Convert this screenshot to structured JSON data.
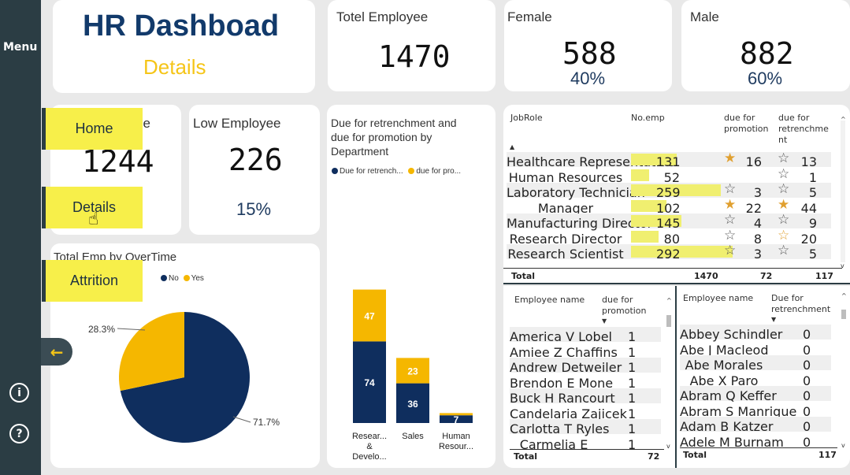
{
  "sidebar": {
    "menu_label": "Menu",
    "info_icon": "i",
    "help_icon": "?"
  },
  "nav": {
    "home": "Home",
    "details": "Details",
    "attrition": "Attrition"
  },
  "header": {
    "title": "HR Dashboad",
    "subtitle": "Details"
  },
  "kpis": {
    "total": {
      "label": "Totel Employee",
      "value": "1470"
    },
    "female": {
      "label": "Female",
      "value": "588",
      "pct": "40%"
    },
    "male": {
      "label": "Male",
      "value": "882",
      "pct": "60%"
    },
    "high": {
      "label": "ee",
      "value": "1244"
    },
    "low": {
      "label": "Low Employee",
      "value": "226",
      "pct": "15%"
    }
  },
  "overtime": {
    "title": "Total Emp by OverTime",
    "legend_no": "No",
    "legend_yes": "Yes",
    "label_yes": "28.3%",
    "label_no": "71.7%"
  },
  "dept_chart": {
    "title_l1": "Due for retrenchment and",
    "title_l2": "due for promotion by",
    "title_l3": "Department",
    "legend_a": "Due for retrench...",
    "legend_b": "due for pro..."
  },
  "chart_data": {
    "type": "bar",
    "stacked": true,
    "categories": [
      "Resear... & Develo...",
      "Sales",
      "Human Resour..."
    ],
    "category_lines": [
      [
        "Resear...",
        "&",
        "Develo..."
      ],
      [
        "Sales"
      ],
      [
        "Human",
        "Resour..."
      ]
    ],
    "series": [
      {
        "name": "Due for retrench...",
        "color": "#0f2e5e",
        "values": [
          74,
          36,
          7
        ]
      },
      {
        "name": "due for pro...",
        "color": "#f5b700",
        "values": [
          47,
          23,
          2
        ]
      }
    ],
    "pie": {
      "values": [
        71.7,
        28.3
      ],
      "names": [
        "No",
        "Yes"
      ],
      "colors": [
        "#0f2e5e",
        "#f5b700"
      ]
    }
  },
  "jobrole": {
    "headers": {
      "role": "JobRole",
      "emp": "No.emp",
      "promo_l1": "due for",
      "promo_l2": "promotion",
      "ret_l1": "due for",
      "ret_l2": "retrenchme",
      "ret_l3": "nt"
    },
    "rows": [
      {
        "role": "Healthcare Representative",
        "emp": "131",
        "empv": 131,
        "promo": "16",
        "pstar": "full",
        "ret": "13",
        "rstar": "empty"
      },
      {
        "role": "Human Resources",
        "emp": "52",
        "empv": 52,
        "promo": "",
        "pstar": "none",
        "ret": "1",
        "rstar": "empty"
      },
      {
        "role": "Laboratory Technician",
        "emp": "259",
        "empv": 259,
        "promo": "3",
        "pstar": "empty",
        "ret": "5",
        "rstar": "empty"
      },
      {
        "role": "Manager",
        "emp": "102",
        "empv": 102,
        "promo": "22",
        "pstar": "full",
        "ret": "44",
        "rstar": "full"
      },
      {
        "role": "Manufacturing Director",
        "emp": "145",
        "empv": 145,
        "promo": "4",
        "pstar": "empty",
        "ret": "9",
        "rstar": "empty"
      },
      {
        "role": "Research Director",
        "emp": "80",
        "empv": 80,
        "promo": "8",
        "pstar": "empty",
        "ret": "20",
        "rstar": "half"
      },
      {
        "role": "Research Scientist",
        "emp": "292",
        "empv": 292,
        "promo": "3",
        "pstar": "empty",
        "ret": "5",
        "rstar": "empty"
      }
    ],
    "total_label": "Total",
    "total_emp": "1470",
    "total_promo": "72",
    "total_ret": "117"
  },
  "promo_list": {
    "col_name": "Employee name",
    "col_val_l1": "due for",
    "col_val_l2": "promotion",
    "rows": [
      {
        "name": "America V Lobel",
        "val": "1"
      },
      {
        "name": "Amiee Z Chaffins",
        "val": "1"
      },
      {
        "name": "Andrew Detweiler",
        "val": "1"
      },
      {
        "name": "Brendon E Mone",
        "val": "1"
      },
      {
        "name": "Buck H Rancourt",
        "val": "1"
      },
      {
        "name": "Candelaria Zajicek",
        "val": "1"
      },
      {
        "name": "Carlotta T Ryles",
        "val": "1"
      },
      {
        "name": "Carmelia E",
        "val": "1"
      }
    ],
    "total_label": "Total",
    "total": "72"
  },
  "ret_list": {
    "col_name": "Employee name",
    "col_val_l1": "Due for",
    "col_val_l2": "retrenchment",
    "rows": [
      {
        "name": "Abbey Schindler",
        "val": "0"
      },
      {
        "name": "Abe J Macleod",
        "val": "0"
      },
      {
        "name": "Abe Morales",
        "val": "0"
      },
      {
        "name": "Abe X Paro",
        "val": "0"
      },
      {
        "name": "Abram Q Keffer",
        "val": "0"
      },
      {
        "name": "Abram S Manrique",
        "val": "0"
      },
      {
        "name": "Adam B Katzer",
        "val": "0"
      },
      {
        "name": "Adele M Burnam",
        "val": "0"
      }
    ],
    "total_label": "Total",
    "total": "117"
  }
}
